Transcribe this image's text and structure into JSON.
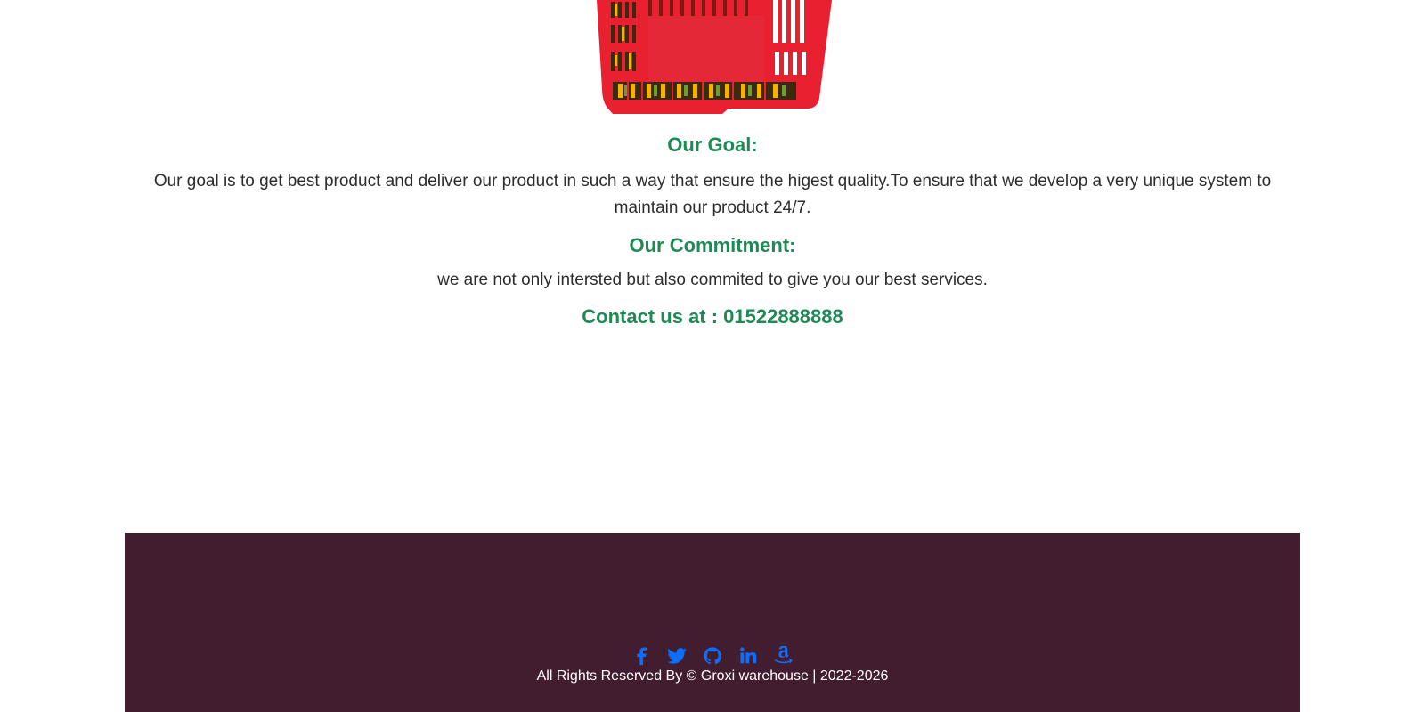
{
  "sections": {
    "goal_title": "Our Goal:",
    "goal_text": "Our goal is to get best product and deliver our product in such a way that ensure the higest quality.To ensure that we develop a very unique system to maintain our product 24/7.",
    "commitment_title": "Our Commitment:",
    "commitment_text": "we are not only intersted but also commited to give you our best services.",
    "contact_title": "Contact us at : 01522888888"
  },
  "footer": {
    "social_icons": [
      "facebook-icon",
      "twitter-icon",
      "github-icon",
      "linkedin-icon",
      "amazon-icon"
    ],
    "copyright": "All Rights Reserved By © Groxi warehouse | 2022-2026",
    "background_color": "#421d2f",
    "icon_color": "#0d6efd"
  },
  "colors": {
    "heading": "#1f8a55",
    "body_text": "#2d2d2d",
    "basket": "#e8202f"
  }
}
